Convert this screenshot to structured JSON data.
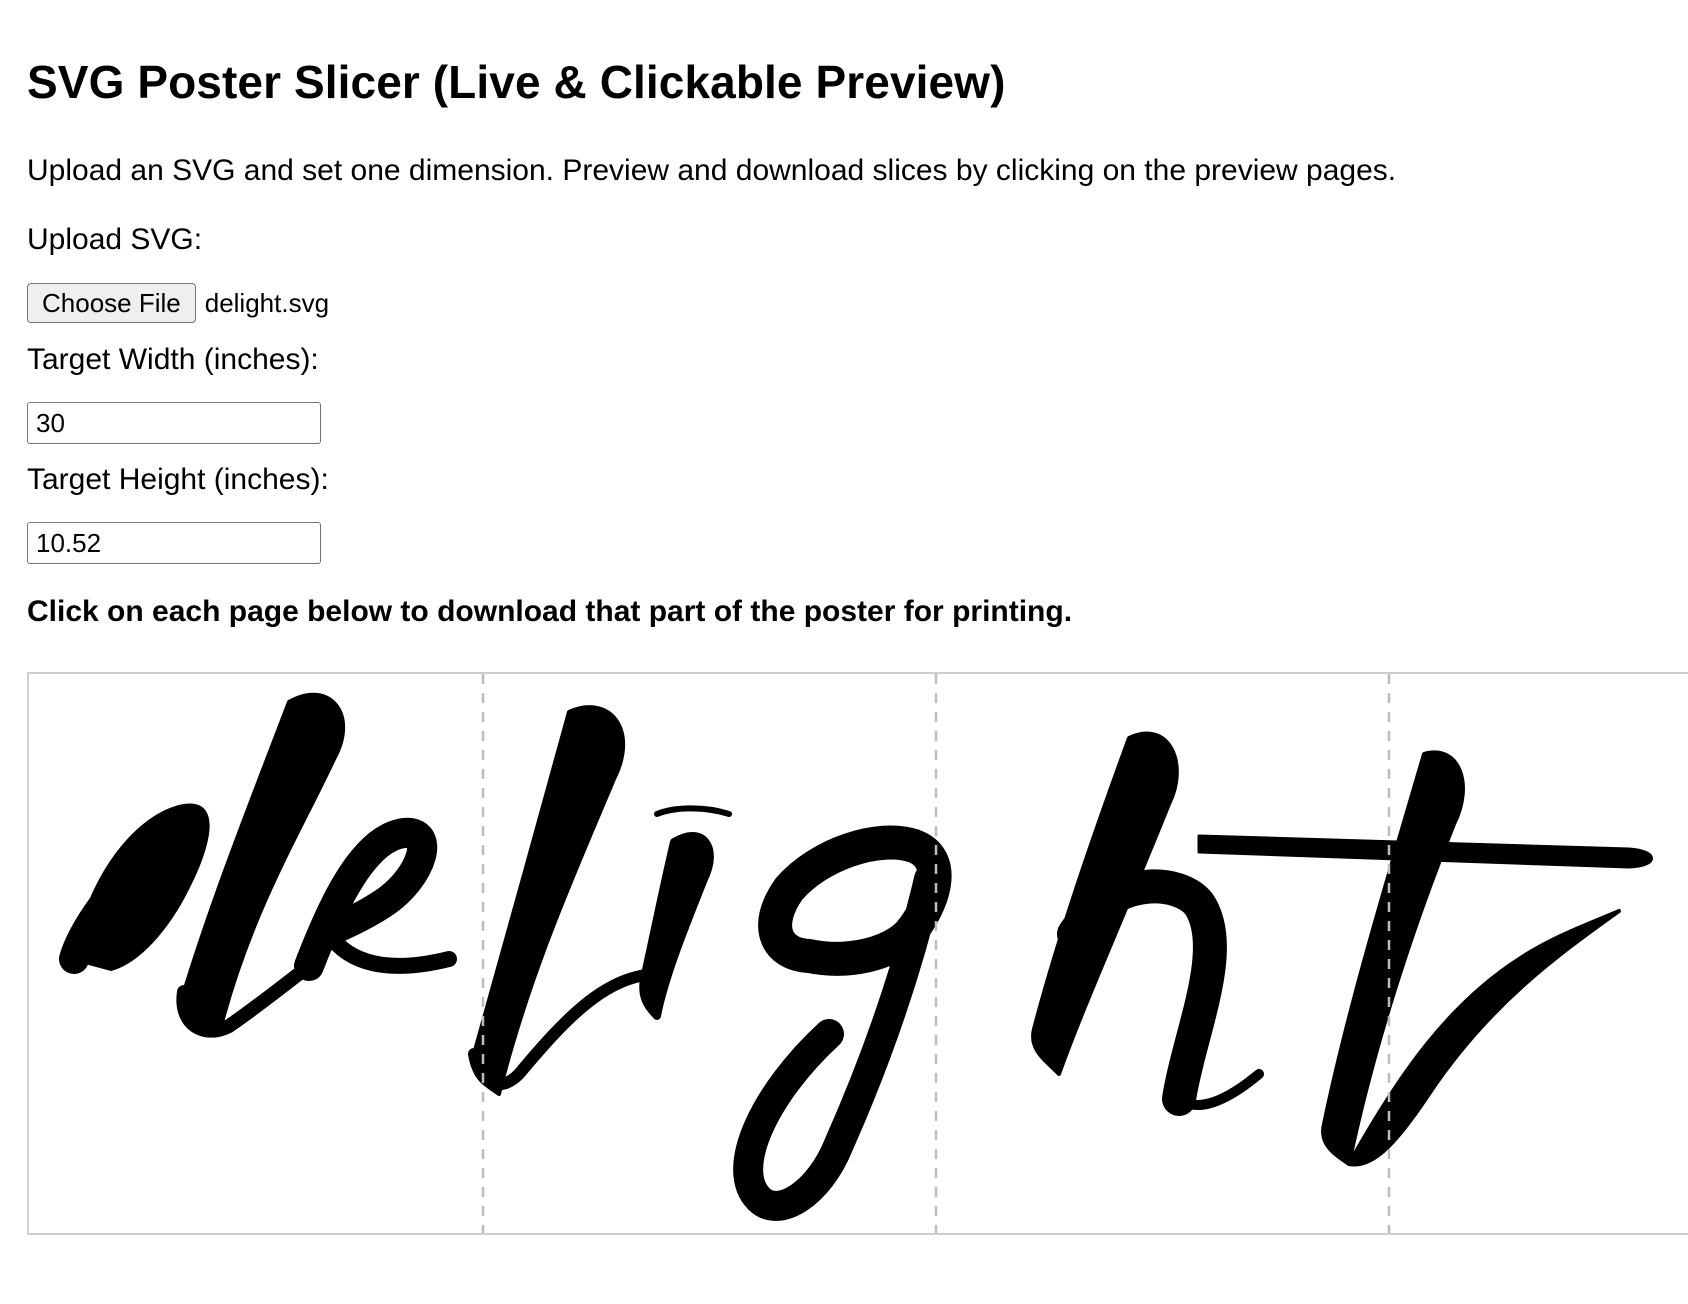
{
  "page": {
    "title": "SVG Poster Slicer (Live & Clickable Preview)",
    "description": "Upload an SVG and set one dimension. Preview and download slices by clicking on the preview pages."
  },
  "upload": {
    "label": "Upload SVG:",
    "button_label": "Choose File",
    "file_name": "delight.svg"
  },
  "width": {
    "label": "Target Width (inches):",
    "value": "30"
  },
  "height": {
    "label": "Target Height (inches):",
    "value": "10.52"
  },
  "preview": {
    "instruction": "Click on each page below to download that part of the poster for printing.",
    "artwork_text": "delight",
    "page_count_visible": 4,
    "divider_color": "#bdbdbd",
    "border_color": "#cfcfcf"
  }
}
